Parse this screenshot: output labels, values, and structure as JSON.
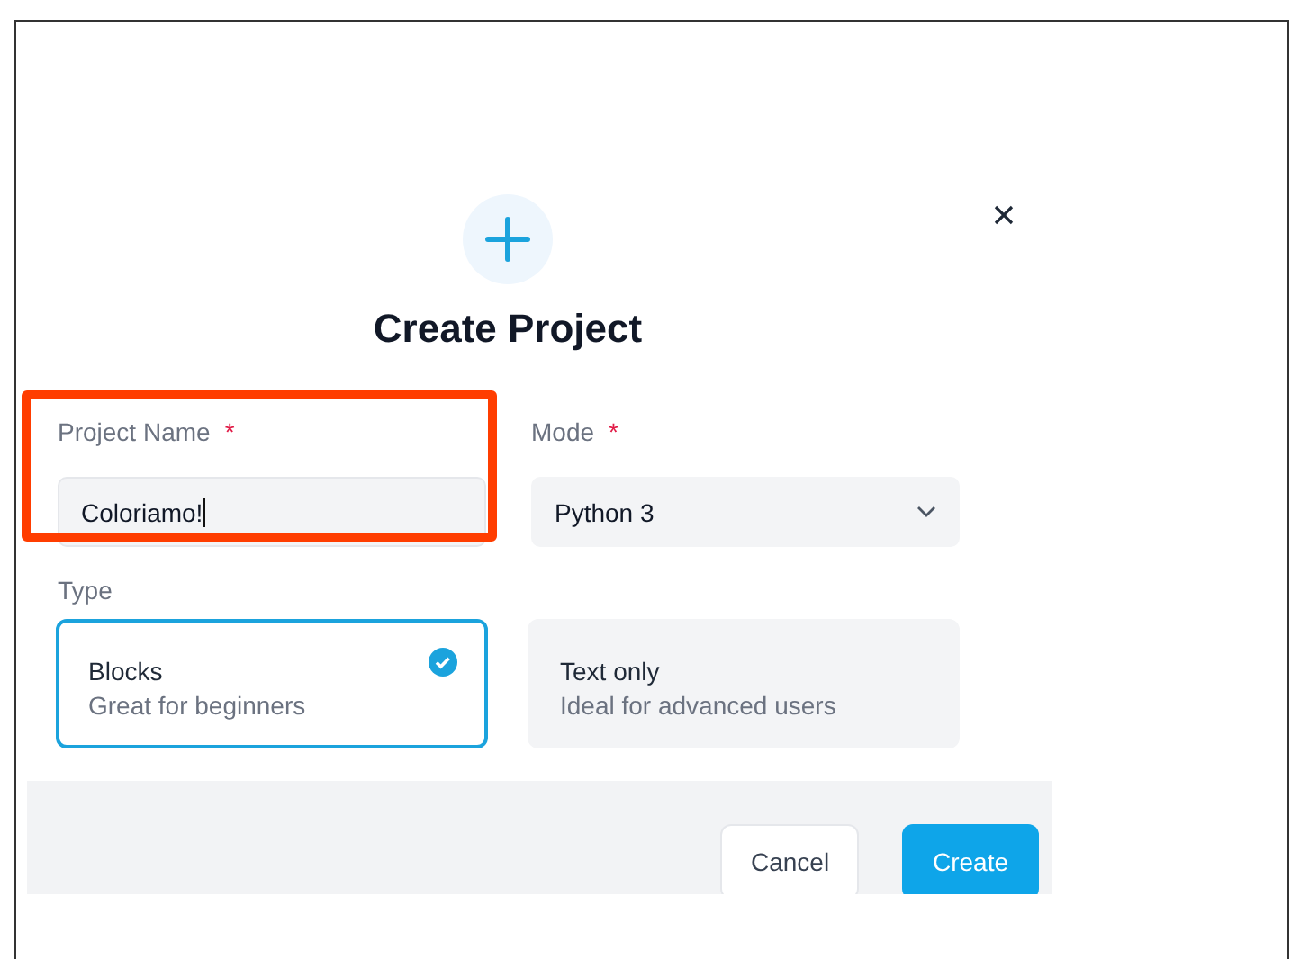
{
  "dialog": {
    "title": "Create Project",
    "fields": [
      {
        "kind": "text",
        "label": "Project Name",
        "required_mark": "*",
        "value": "Coloriamo!",
        "highlighted": true
      },
      {
        "kind": "select",
        "label": "Mode",
        "required_mark": "*",
        "value": "Python 3",
        "highlighted": false
      }
    ],
    "type": {
      "label": "Type",
      "options": [
        {
          "title": "Blocks",
          "subtitle": "Great for beginners",
          "selected": true
        },
        {
          "title": "Text only",
          "subtitle": "Ideal for advanced users",
          "selected": false
        }
      ]
    },
    "buttons": [
      {
        "label": "Cancel",
        "kind": "secondary"
      },
      {
        "label": "Create",
        "kind": "primary"
      }
    ]
  }
}
